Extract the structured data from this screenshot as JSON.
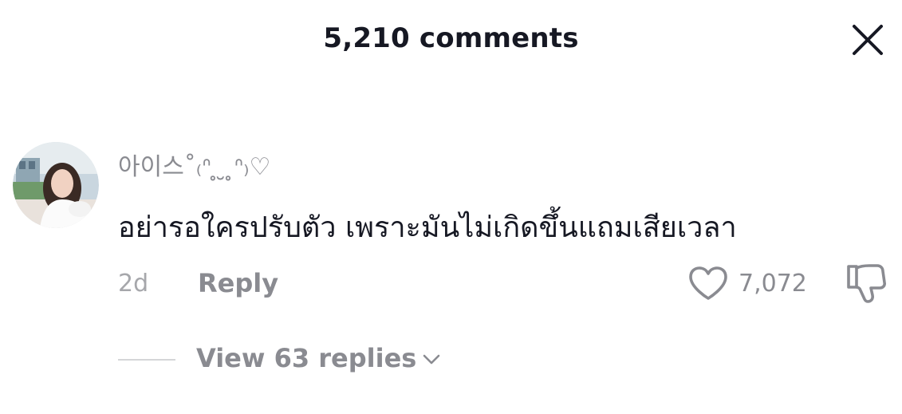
{
  "header": {
    "title": "5,210 comments"
  },
  "comment": {
    "username": "아이스˚₍ᐢ ̥ ̮ ̥ᐢ₎♡",
    "text": "อย่ารอใครปรับตัว เพราะมันไม่เกิดขึ้นแถมเสียเวลา",
    "timestamp": "2d",
    "reply_label": "Reply",
    "like_count": "7,072",
    "view_replies_label": "View 63 replies"
  },
  "icons": {
    "close": "close-icon",
    "like": "heart-outline-icon",
    "dislike": "thumbs-down-icon",
    "expand": "chevron-down-icon"
  },
  "colors": {
    "primary_text": "#161823",
    "secondary_text": "#8a8b91",
    "muted_text": "#a6a7ab",
    "divider": "#d5d6d8"
  }
}
